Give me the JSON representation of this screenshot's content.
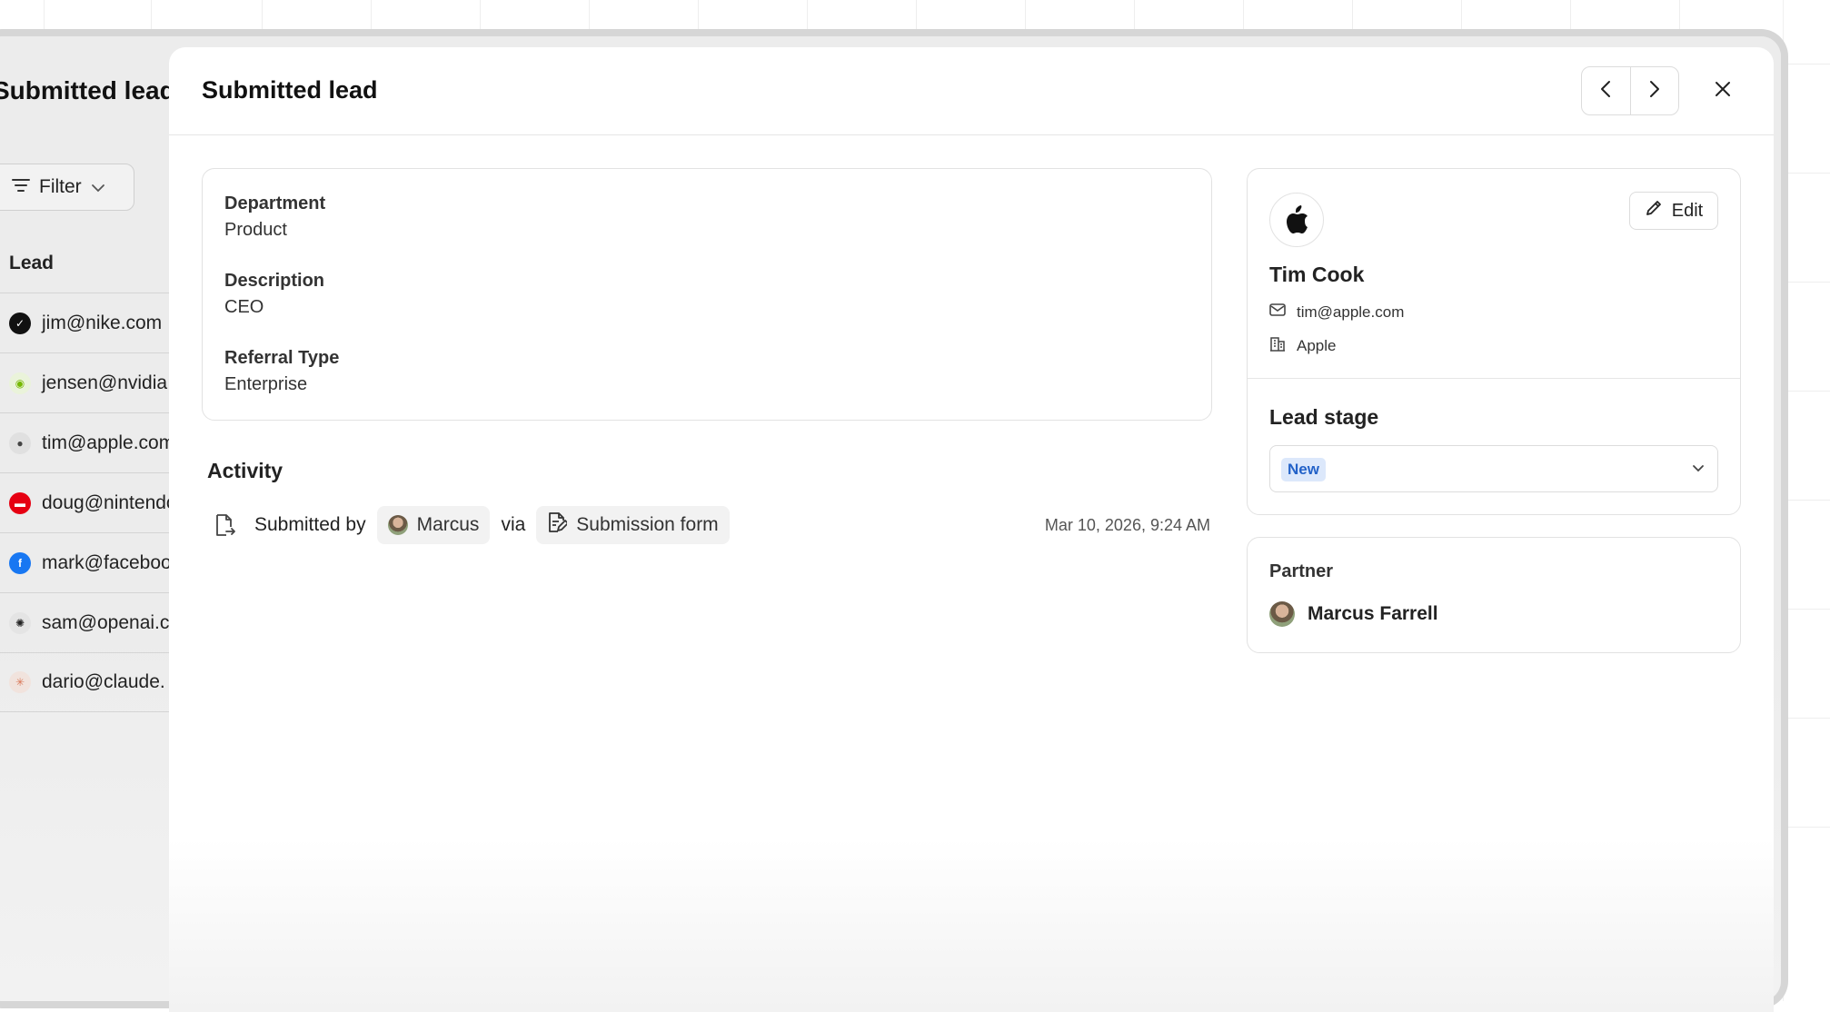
{
  "background_page": {
    "title": "Submitted leads",
    "filter_label": "Filter",
    "column_header": "Lead",
    "leads": [
      {
        "email": "jim@nike.com",
        "logo": "nike-logo-icon",
        "color": "#111111"
      },
      {
        "email": "jensen@nvidia",
        "logo": "nvidia-logo-icon",
        "color": "#76b900"
      },
      {
        "email": "tim@apple.com",
        "logo": "apple-logo-icon",
        "color": "#555555"
      },
      {
        "email": "doug@nintendo",
        "logo": "nintendo-logo-icon",
        "color": "#e60012"
      },
      {
        "email": "mark@facebook",
        "logo": "facebook-logo-icon",
        "color": "#1877f2"
      },
      {
        "email": "sam@openai.c",
        "logo": "openai-logo-icon",
        "color": "#222222"
      },
      {
        "email": "dario@claude.",
        "logo": "claude-logo-icon",
        "color": "#d97757"
      }
    ]
  },
  "modal": {
    "title": "Submitted lead",
    "details": {
      "department_label": "Department",
      "department_value": "Product",
      "description_label": "Description",
      "description_value": "CEO",
      "referral_label": "Referral Type",
      "referral_value": "Enterprise"
    },
    "activity": {
      "title": "Activity",
      "submitted_by_label": "Submitted by",
      "submitter": "Marcus",
      "via_label": "via",
      "source": "Submission form",
      "timestamp": "Mar 10, 2026, 9:24 AM"
    },
    "contact": {
      "name": "Tim Cook",
      "email": "tim@apple.com",
      "company": "Apple",
      "edit_label": "Edit",
      "lead_stage_title": "Lead stage",
      "lead_stage_value": "New"
    },
    "partner": {
      "label": "Partner",
      "name": "Marcus Farrell"
    }
  },
  "colors": {
    "stage_badge_bg": "#dce8fb",
    "stage_badge_text": "#2362c8"
  }
}
